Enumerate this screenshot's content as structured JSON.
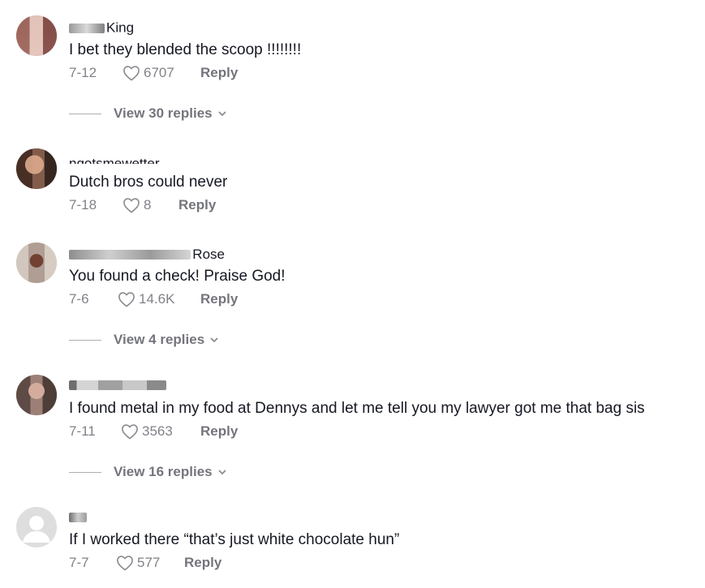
{
  "comments": [
    {
      "username": "King",
      "text": "I bet they blended the scoop !!!!!!!!",
      "date": "7-12",
      "likes": "6707",
      "reply": "Reply",
      "view_replies": "View 30 replies"
    },
    {
      "username": "ngotsmewetter",
      "text": "Dutch bros could never",
      "date": "7-18",
      "likes": "8",
      "reply": "Reply"
    },
    {
      "username": "Felecia Kimberly Rose",
      "text": "You found a check! Praise God!",
      "date": "7-6",
      "likes": "14.6K",
      "reply": "Reply",
      "view_replies": "View 4 replies"
    },
    {
      "username": "",
      "text": "I found metal in my food at Dennys and let me tell you my lawyer got me that bag sis",
      "date": "7-11",
      "likes": "3563",
      "reply": "Reply",
      "view_replies": "View 16 replies"
    },
    {
      "username": "",
      "text": "If I worked there “that’s just white chocolate hun”",
      "date": "7-7",
      "likes": "577",
      "reply": "Reply"
    }
  ],
  "icons": {
    "like": "heart-outline-icon",
    "expand": "chevron-down-icon",
    "default_avatar": "default-user-avatar-icon"
  },
  "colors": {
    "text": "#161823",
    "muted": "#8a8b91"
  }
}
